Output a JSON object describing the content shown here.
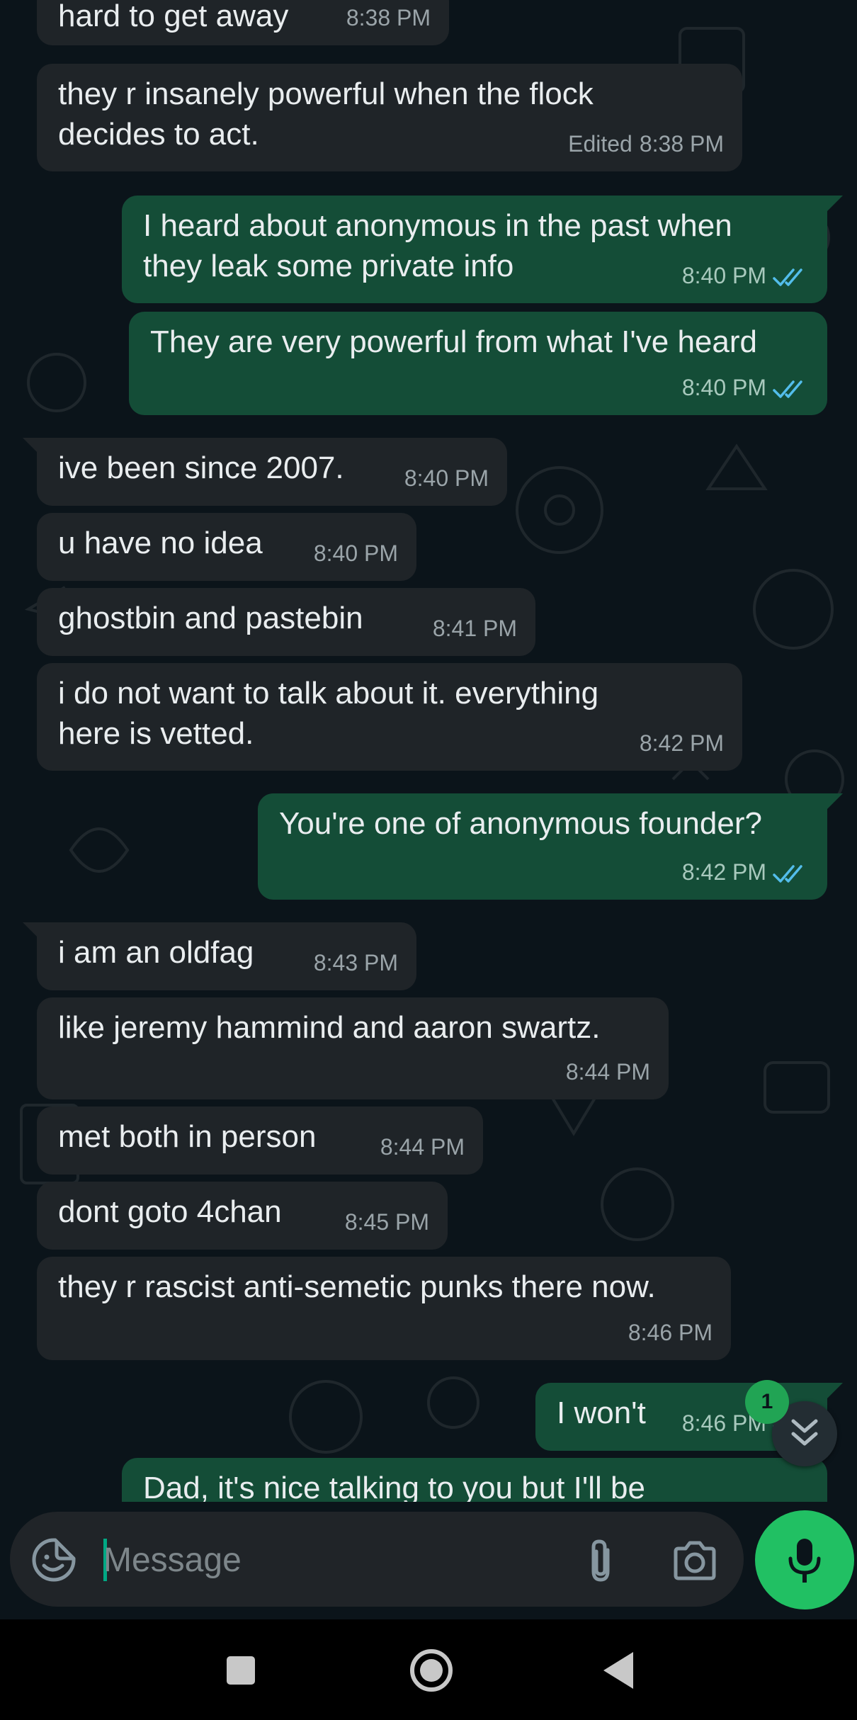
{
  "colors": {
    "background": "#0b141a",
    "incoming_bubble": "#1f2428",
    "outgoing_bubble": "#144d37",
    "read_ticks": "#53bdeb",
    "accent_green": "#21c063"
  },
  "messages": [
    {
      "dir": "in",
      "text": "hard to get away",
      "time": "8:38 PM",
      "edited": ""
    },
    {
      "dir": "in",
      "text": "they r insanely powerful when the flock\ndecides to act.",
      "time": "8:38 PM",
      "edited": "Edited"
    },
    {
      "dir": "out",
      "text": "I heard about anonymous in the past when\nthey leak some private info",
      "time": "8:40 PM",
      "status": "read"
    },
    {
      "dir": "out",
      "text": "They are very powerful from what I've heard",
      "time": "8:40 PM",
      "status": "read"
    },
    {
      "dir": "in",
      "text": "ive been since 2007.",
      "time": "8:40 PM",
      "edited": ""
    },
    {
      "dir": "in",
      "text": "u have no idea",
      "time": "8:40 PM",
      "edited": ""
    },
    {
      "dir": "in",
      "text": "ghostbin and pastebin",
      "time": "8:41 PM",
      "edited": ""
    },
    {
      "dir": "in",
      "text": "i do not want to talk about it. everything\nhere is vetted.",
      "time": "8:42 PM",
      "edited": ""
    },
    {
      "dir": "out",
      "text": "You're one of anonymous founder?",
      "time": "8:42 PM",
      "status": "read"
    },
    {
      "dir": "in",
      "text": "i am an oldfag",
      "time": "8:43 PM",
      "edited": ""
    },
    {
      "dir": "in",
      "text": "like jeremy hammind and aaron swartz.",
      "time": "8:44 PM",
      "edited": ""
    },
    {
      "dir": "in",
      "text": "met both in person",
      "time": "8:44 PM",
      "edited": ""
    },
    {
      "dir": "in",
      "text": "dont goto 4chan",
      "time": "8:45 PM",
      "edited": ""
    },
    {
      "dir": "in",
      "text": "they r rascist anti-semetic punks there now.",
      "time": "8:46 PM",
      "edited": ""
    },
    {
      "dir": "out",
      "text": "I won't",
      "time": "8:46 PM",
      "status": "read"
    },
    {
      "dir": "out",
      "text": "Dad, it's nice talking to you but I'll be",
      "time": "",
      "status": ""
    }
  ],
  "scroll_down": {
    "icon": "double-chevron-down-icon",
    "unread_count": "1"
  },
  "composer": {
    "placeholder": "Message",
    "emoji_icon": "sticker-smiley-icon",
    "attach_icon": "paperclip-icon",
    "camera_icon": "camera-icon",
    "mic_icon": "microphone-icon"
  },
  "nav_bar": {
    "recents_icon": "square-icon",
    "home_icon": "circle-icon",
    "back_icon": "triangle-back-icon"
  }
}
